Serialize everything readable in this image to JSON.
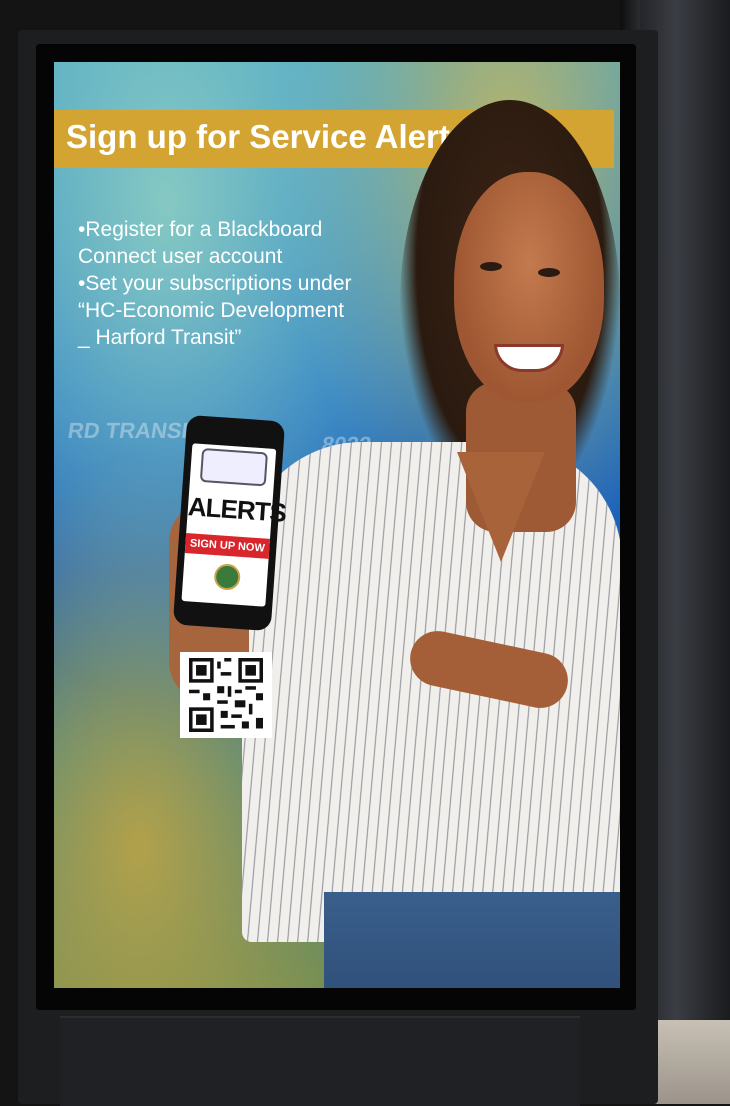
{
  "poster": {
    "banner_title": "Sign up for Service Alerts",
    "bullets": [
      "•Register for a Blackboard",
      " Connect user account",
      "•Set your subscriptions under",
      " “HC-Economic Development",
      " _ Harford Transit”"
    ],
    "background_text": [
      "RD TRANSIT",
      "8032"
    ]
  },
  "phone": {
    "alerts_label": "ALERTS",
    "signup_label": "SIGN UP NOW"
  },
  "colors": {
    "banner": "#d4a432",
    "signup_red": "#d8262c"
  }
}
